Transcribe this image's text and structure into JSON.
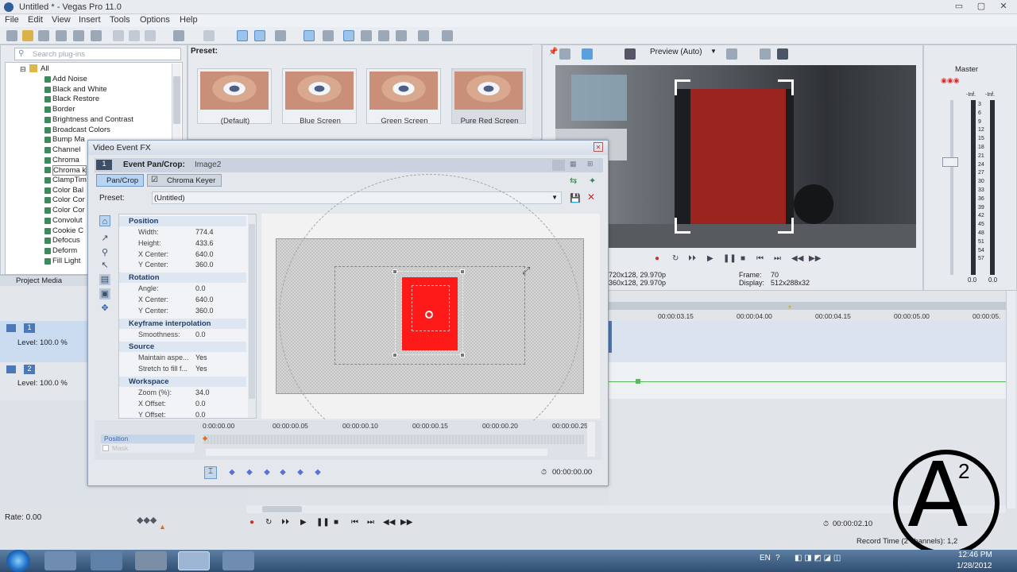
{
  "window": {
    "title": "Untitled * - Vegas Pro 11.0",
    "min": "▭",
    "max": "▢",
    "close": "✕"
  },
  "menu": [
    "File",
    "Edit",
    "View",
    "Insert",
    "Tools",
    "Options",
    "Help"
  ],
  "plugin_search": {
    "placeholder": "Search plug-ins"
  },
  "tree": {
    "root": "All",
    "items": [
      "Add Noise",
      "Black and White",
      "Black Restore",
      "Border",
      "Brightness and Contrast",
      "Broadcast Colors",
      "Bump Ma",
      "Channel",
      "Chroma",
      "Chroma k",
      "ClampTim",
      "Color Bal",
      "Color Cor",
      "Color Cor",
      "Convolut",
      "Cookie C",
      "Defocus",
      "Deform",
      "Fill Light"
    ]
  },
  "presets": {
    "label": "Preset:",
    "items": [
      "(Default)",
      "Blue Screen",
      "Green Screen",
      "Pure Red Screen"
    ]
  },
  "project_media_tab": "Project Media",
  "tracks": [
    {
      "number": "1",
      "level": "Level: 100.0 %"
    },
    {
      "number": "2",
      "level": "Level: 100.0 %"
    }
  ],
  "rate": "Rate: 0.00",
  "preview": {
    "label": "Preview (Auto)",
    "project_info": "720x128, 29.970p",
    "preview_info": "360x128, 29.970p",
    "frame_label": "Frame:",
    "frame": "70",
    "display_label": "Display:",
    "display": "512x288x32"
  },
  "master": {
    "label": "Master",
    "left_inf": "-Inf.",
    "right_inf": "-Inf.",
    "scale": [
      "3",
      "6",
      "9",
      "12",
      "15",
      "18",
      "21",
      "24",
      "27",
      "30",
      "33",
      "36",
      "39",
      "42",
      "45",
      "48",
      "51",
      "54",
      "57"
    ],
    "left_value": "0.0",
    "right_value": "0.0"
  },
  "timeline_ruler": [
    "00:00:03.15",
    "00:00:04.00",
    "00:00:04.15",
    "00:00:05.00",
    "00:00:05."
  ],
  "time_readout": "00:00:02.10",
  "record_time": "Record Time (2 channels): 1,2",
  "dialog": {
    "title": "Video Event FX",
    "close": "✕",
    "event_label": "Event Pan/Crop:",
    "event_name": "Image2",
    "chain_number": "1",
    "tabs": [
      "Pan/Crop",
      "Chroma Keyer"
    ],
    "preset_label": "Preset:",
    "preset_value": "(Untitled)",
    "groups": [
      {
        "name": "Position",
        "rows": [
          [
            "Width:",
            "774.4"
          ],
          [
            "Height:",
            "433.6"
          ],
          [
            "X Center:",
            "640.0"
          ],
          [
            "Y Center:",
            "360.0"
          ]
        ]
      },
      {
        "name": "Rotation",
        "rows": [
          [
            "Angle:",
            "0.0"
          ],
          [
            "X Center:",
            "640.0"
          ],
          [
            "Y Center:",
            "360.0"
          ]
        ]
      },
      {
        "name": "Keyframe interpolation",
        "rows": [
          [
            "Smoothness:",
            "0.0"
          ]
        ]
      },
      {
        "name": "Source",
        "rows": [
          [
            "Maintain aspe...",
            "Yes"
          ],
          [
            "Stretch to fill f...",
            "Yes"
          ]
        ]
      },
      {
        "name": "Workspace",
        "rows": [
          [
            "Zoom (%):",
            "34.0"
          ],
          [
            "X Offset:",
            "0.0"
          ],
          [
            "Y Offset:",
            "0.0"
          ]
        ]
      }
    ],
    "timeline_ticks": [
      "0:00:00.00",
      "00:00:00.05",
      "00:00:00.10",
      "00:00:00.15",
      "00:00:00.20",
      "00:00:00.25"
    ],
    "track_label": "Position",
    "track_label2": "Mask",
    "time": "00:00:00.00"
  },
  "taskbar": {
    "lang": "EN",
    "time": "12:46 PM",
    "date": "1/28/2012"
  },
  "watermark": {
    "glyph": "A",
    "superscript": "2"
  },
  "colors": {
    "red_key": "#ff1a1a",
    "accent": "#4b78b8",
    "selection": "#c8dcf5"
  }
}
